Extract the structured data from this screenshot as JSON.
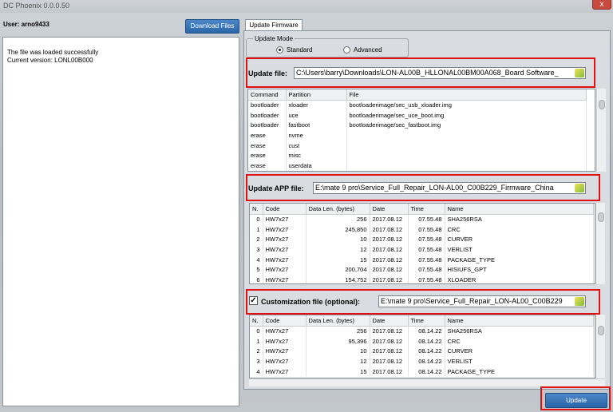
{
  "window": {
    "title": "DC Phoenix 0.0.0.50",
    "close_label": "x"
  },
  "user": {
    "label": "User: arno9433"
  },
  "toolbar": {
    "download_label": "Download Files"
  },
  "log": {
    "lines": [
      "The file was loaded successfully",
      "Current version: LONL00B000"
    ]
  },
  "tabs": {
    "update_firmware": "Update Firmware"
  },
  "update_mode": {
    "legend": "Update Mode",
    "standard": "Standard",
    "advanced": "Advanced",
    "selected": "Standard"
  },
  "update_file": {
    "label": "Update file:",
    "value": "C:\\Users\\barry\\Downloads\\LON-AL00B_HLLONAL00BM00A068_Board Software_"
  },
  "firmware_table": {
    "headers": [
      "Command",
      "Partition",
      "File"
    ],
    "rows": [
      [
        "bootloader",
        "xloader",
        "bootloaderimage/sec_usb_xloader.img"
      ],
      [
        "bootloader",
        "uce",
        "bootloaderimage/sec_uce_boot.img"
      ],
      [
        "bootloader",
        "fastboot",
        "bootloaderimage/sec_fastboot.img"
      ],
      [
        "erase",
        "nvme",
        ""
      ],
      [
        "erase",
        "cust",
        ""
      ],
      [
        "erase",
        "misc",
        ""
      ],
      [
        "erase",
        "userdata",
        ""
      ]
    ]
  },
  "app_file": {
    "label": "Update APP file:",
    "value": "E:\\mate 9 pro\\Service_Full_Repair_LON-AL00_C00B229_Firmware_China"
  },
  "app_table": {
    "headers": [
      "N.",
      "Code",
      "Data Len. (bytes)",
      "Date",
      "Time",
      "Name"
    ],
    "rows": [
      [
        "0",
        "HW7x27",
        "256",
        "2017.08.12",
        "07.55.48",
        "SHA256RSA"
      ],
      [
        "1",
        "HW7x27",
        "245,850",
        "2017.08.12",
        "07.55.48",
        "CRC"
      ],
      [
        "2",
        "HW7x27",
        "10",
        "2017.08.12",
        "07.55.48",
        "CURVER"
      ],
      [
        "3",
        "HW7x27",
        "12",
        "2017.08.12",
        "07.55.48",
        "VERLIST"
      ],
      [
        "4",
        "HW7x27",
        "15",
        "2017.08.12",
        "07.55.48",
        "PACKAGE_TYPE"
      ],
      [
        "5",
        "HW7x27",
        "200,704",
        "2017.08.12",
        "07.55.48",
        "HISIUFS_GPT"
      ],
      [
        "6",
        "HW7x27",
        "154,752",
        "2017.08.12",
        "07.55.48",
        "XLOADER"
      ]
    ]
  },
  "custom_file": {
    "checked": true,
    "check_mark": "✓",
    "label": "Customization file (optional):",
    "value": "E:\\mate 9 pro\\Service_Full_Repair_LON-AL00_C00B229"
  },
  "custom_table": {
    "headers": [
      "N.",
      "Code",
      "Data Len. (bytes)",
      "Date",
      "Time",
      "Name"
    ],
    "rows": [
      [
        "0",
        "HW7x27",
        "256",
        "2017.08.12",
        "08.14.22",
        "SHA256RSA"
      ],
      [
        "1",
        "HW7x27",
        "95,396",
        "2017.08.12",
        "08.14.22",
        "CRC"
      ],
      [
        "2",
        "HW7x27",
        "10",
        "2017.08.12",
        "08.14.22",
        "CURVER"
      ],
      [
        "3",
        "HW7x27",
        "12",
        "2017.08.12",
        "08.14.22",
        "VERLIST"
      ],
      [
        "4",
        "HW7x27",
        "15",
        "2017.08.12",
        "08.14.22",
        "PACKAGE_TYPE"
      ]
    ]
  },
  "actions": {
    "update_label": "Update"
  },
  "colors": {
    "accent": "#2a66a8",
    "highlight": "#e01010"
  }
}
